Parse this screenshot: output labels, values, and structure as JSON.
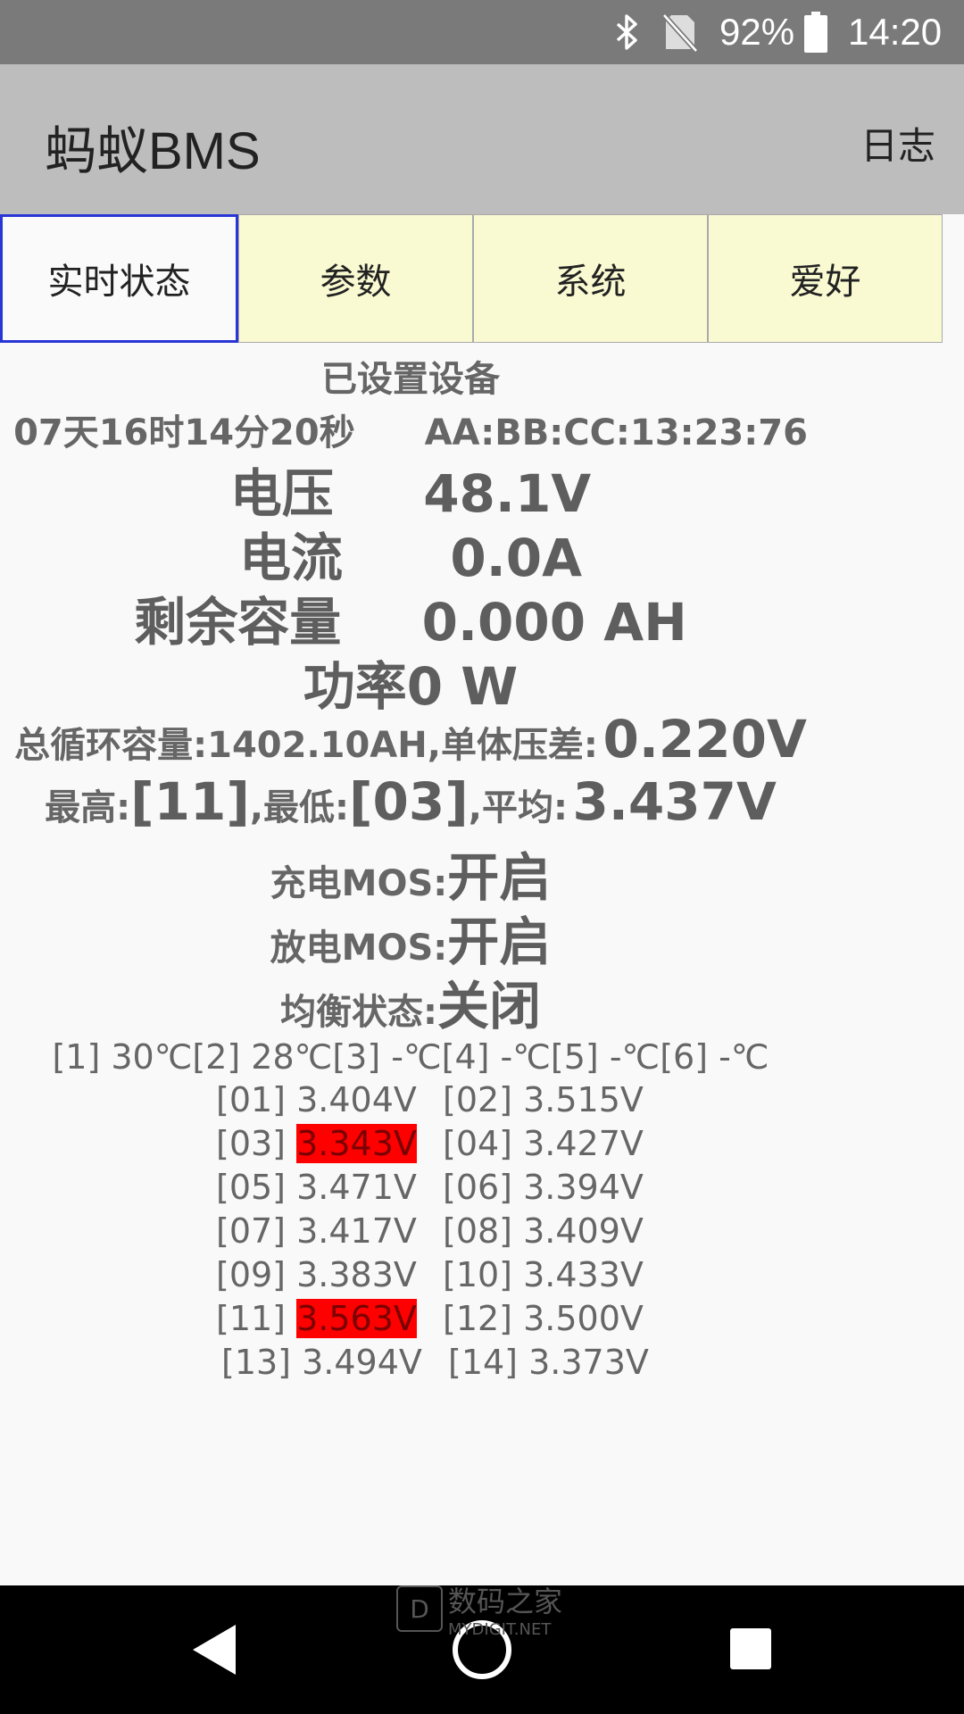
{
  "status_bar": {
    "battery_percent": "92%",
    "time": "14:20",
    "icons": [
      "bluetooth-icon",
      "no-sim-icon",
      "battery-icon"
    ],
    "background": "#7a7a7a"
  },
  "app_bar": {
    "title": "蚂蚁BMS",
    "log_button": "日志",
    "background": "#bdbdbd"
  },
  "tabs": [
    {
      "label": "实时状态",
      "active": true
    },
    {
      "label": "参数",
      "active": false
    },
    {
      "label": "系统",
      "active": false
    },
    {
      "label": "爱好",
      "active": false
    }
  ],
  "status": {
    "device_label": "已设置设备",
    "uptime": "07天16时14分20秒",
    "mac": "AA:BB:CC:13:23:76",
    "voltage_label": "电压",
    "voltage": "48.1V",
    "current_label": "电流",
    "current": "0.0A",
    "remaining_label": "剩余容量",
    "remaining": "0.000 AH",
    "power_label": "功率",
    "power": "0 W",
    "total_cycle_label": "总循环容量:",
    "total_cycle": "1402.10AH,",
    "cell_diff_label": "单体压差:",
    "cell_diff": "0.220V",
    "highest_label": "最高:",
    "highest": "[11]",
    "lowest_label": ",最低:",
    "lowest": "[03]",
    "average_label": ",平均:",
    "average": "3.437V",
    "charge_mos_label": "充电MOS:",
    "charge_mos": "开启",
    "discharge_mos_label": "放电MOS:",
    "discharge_mos": "开启",
    "balance_label": "均衡状态:",
    "balance": "关闭",
    "temperatures": "[1] 30℃[2] 28℃[3] -℃[4] -℃[5] -℃[6] -℃"
  },
  "cells": [
    {
      "id": "[01]",
      "value": "3.404V",
      "highlight": false
    },
    {
      "id": "[02]",
      "value": "3.515V",
      "highlight": false
    },
    {
      "id": "[03]",
      "value": "3.343V",
      "highlight": true
    },
    {
      "id": "[04]",
      "value": "3.427V",
      "highlight": false
    },
    {
      "id": "[05]",
      "value": "3.471V",
      "highlight": false
    },
    {
      "id": "[06]",
      "value": "3.394V",
      "highlight": false
    },
    {
      "id": "[07]",
      "value": "3.417V",
      "highlight": false
    },
    {
      "id": "[08]",
      "value": "3.409V",
      "highlight": false
    },
    {
      "id": "[09]",
      "value": "3.383V",
      "highlight": false
    },
    {
      "id": "[10]",
      "value": "3.433V",
      "highlight": false
    },
    {
      "id": "[11]",
      "value": "3.563V",
      "highlight": true
    },
    {
      "id": "[12]",
      "value": "3.500V",
      "highlight": false
    },
    {
      "id": "[13]",
      "value": "3.494V",
      "highlight": false
    },
    {
      "id": "[14]",
      "value": "3.373V",
      "highlight": false
    }
  ],
  "watermark": {
    "text": "数码之家",
    "sub": "MYDIGIT.NET"
  },
  "nav": {
    "icons": [
      "back-icon",
      "home-icon",
      "recents-icon"
    ]
  },
  "colors": {
    "active_tab_border": "#2a35d6",
    "tab_bg": "#fafad2",
    "highlight": "#ff0000"
  }
}
